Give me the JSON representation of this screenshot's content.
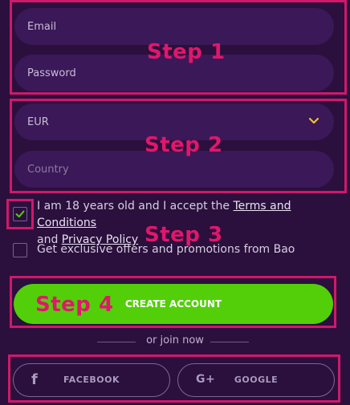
{
  "form": {
    "email_placeholder": "Email",
    "password_placeholder": "Password",
    "currency_value": "EUR",
    "country_placeholder": "Country"
  },
  "consent": {
    "age_prefix": "I am 18 years old and I accept the ",
    "terms_link": "Terms and Conditions",
    "and_text": "and ",
    "privacy_link": "Privacy Policy",
    "offers_text": "Get exclusive offers and promotions from Bao"
  },
  "actions": {
    "create_account": "CREATE ACCOUNT",
    "join_text": "or join now",
    "facebook": "FACEBOOK",
    "google": "GOOGLE"
  },
  "annotations": {
    "step1": "Step 1",
    "step2": "Step 2",
    "step3": "Step 3",
    "step4": "Step 4"
  },
  "icons": {
    "currency_dropdown": "chevron-down-icon",
    "age_checkbox": "check-icon",
    "facebook": "facebook-icon",
    "google": "google-plus-icon"
  },
  "colors": {
    "background": "#2b0f3d",
    "field": "#3b1858",
    "accent_green": "#52cf09",
    "annotation": "#d0186a",
    "chevron": "#f2c12e"
  }
}
